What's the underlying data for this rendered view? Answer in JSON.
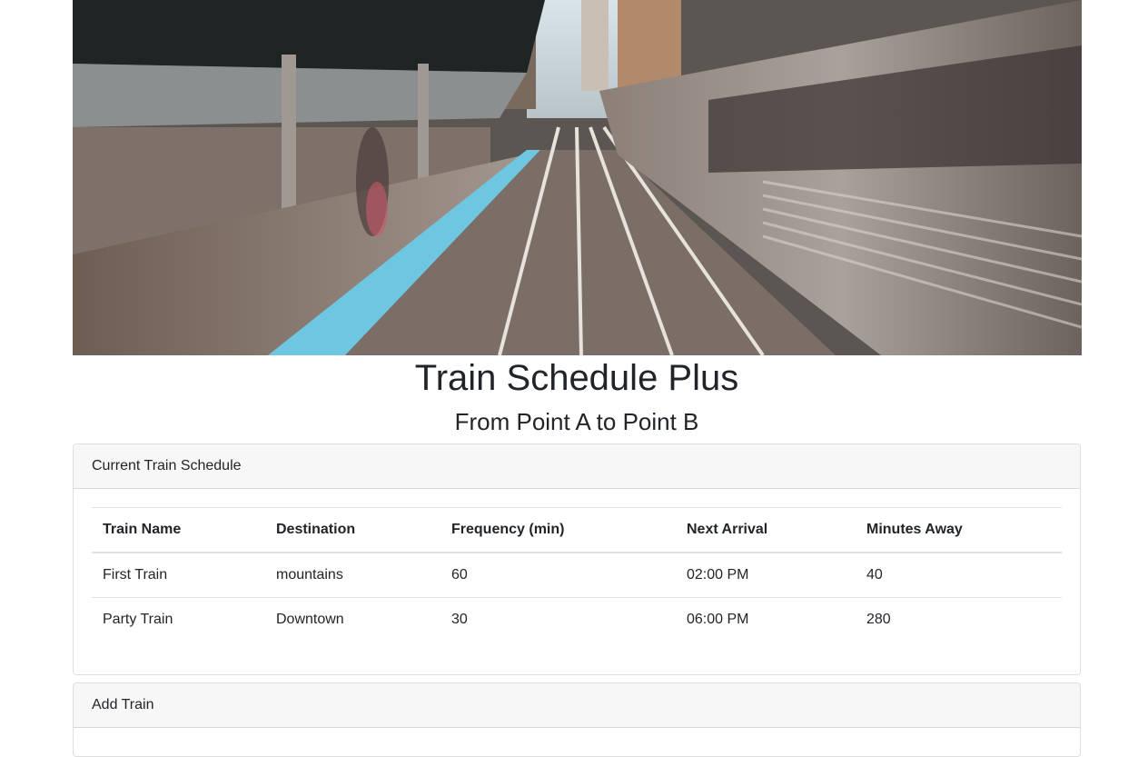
{
  "header": {
    "title": "Train Schedule Plus",
    "subtitle": "From Point A to Point B"
  },
  "schedule": {
    "heading": "Current Train Schedule",
    "columns": [
      "Train Name",
      "Destination",
      "Frequency (min)",
      "Next Arrival",
      "Minutes Away"
    ],
    "rows": [
      [
        "First Train",
        "mountains",
        "60",
        "02:00 PM",
        "40"
      ],
      [
        "Party Train",
        "Downtown",
        "30",
        "06:00 PM",
        "280"
      ]
    ]
  },
  "add_train": {
    "heading": "Add Train"
  },
  "colors": {
    "card_header_bg": "#f7f7f7",
    "platform_edge": "#6ec6e0"
  }
}
